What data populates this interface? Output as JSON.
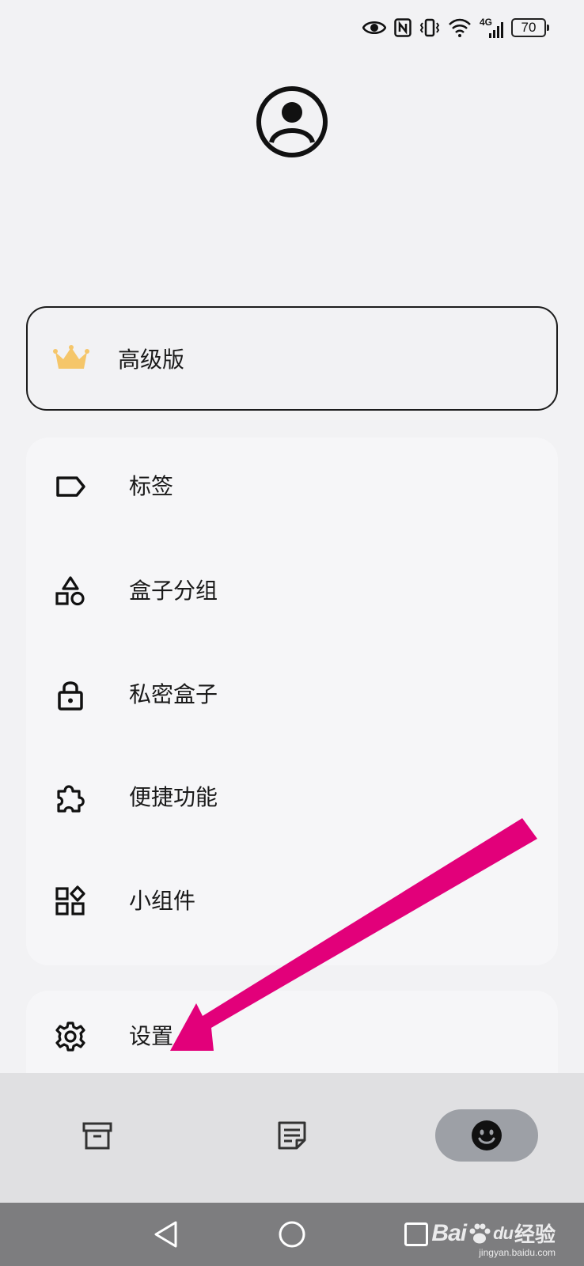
{
  "status_bar": {
    "network_label": "4G",
    "battery_level": "70",
    "icons": [
      "eye-icon",
      "nfc-icon",
      "vibrate-icon",
      "wifi-icon",
      "signal-icon",
      "battery-icon"
    ]
  },
  "profile": {
    "avatar_icon": "user-circle-icon"
  },
  "premium": {
    "label": "高级版",
    "icon": "crown-icon",
    "icon_color": "#f5c66a"
  },
  "menu": {
    "items": [
      {
        "label": "标签",
        "icon": "tag-icon"
      },
      {
        "label": "盒子分组",
        "icon": "shapes-icon"
      },
      {
        "label": "私密盒子",
        "icon": "lock-icon"
      },
      {
        "label": "便捷功能",
        "icon": "puzzle-icon"
      },
      {
        "label": "小组件",
        "icon": "widgets-icon"
      }
    ]
  },
  "settings": {
    "label": "设置",
    "icon": "gear-icon"
  },
  "bottom_nav": {
    "items": [
      {
        "icon": "archive-box-icon",
        "active": false
      },
      {
        "icon": "note-icon",
        "active": false
      },
      {
        "icon": "smiley-icon",
        "active": true
      }
    ]
  },
  "system_nav": {
    "buttons": [
      "back-icon",
      "home-icon",
      "recents-icon"
    ]
  },
  "watermark": {
    "brand": "Bai",
    "brand_suffix": "du",
    "product": "经验",
    "url": "jingyan.baidu.com"
  },
  "annotation": {
    "color": "#e2007a"
  }
}
